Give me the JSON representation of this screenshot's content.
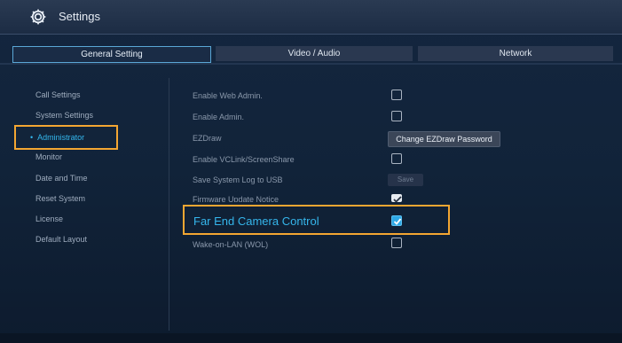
{
  "window": {
    "title": "Settings",
    "icon": "gear-icon"
  },
  "tabs": [
    {
      "label": "General Setting",
      "active": true
    },
    {
      "label": "Video / Audio",
      "active": false
    },
    {
      "label": "Network",
      "active": false
    }
  ],
  "sidebar": {
    "items": [
      {
        "label": "Call Settings"
      },
      {
        "label": "System Settings"
      },
      {
        "label": "Administrator",
        "active": true,
        "bullet": "•"
      },
      {
        "label": "Monitor"
      },
      {
        "label": "Date and Time"
      },
      {
        "label": "Reset System"
      },
      {
        "label": "License"
      },
      {
        "label": "Default Layout"
      }
    ]
  },
  "settings": {
    "rows": [
      {
        "label": "Enable Web Admin.",
        "control": "checkbox",
        "checked": false
      },
      {
        "label": "Enable Admin.",
        "control": "checkbox",
        "checked": false
      },
      {
        "label": "EZDraw",
        "control": "button",
        "button_label": "Change EZDraw Password"
      },
      {
        "label": "Enable VCLink/ScreenShare",
        "control": "checkbox",
        "checked": false
      },
      {
        "label": "Save System Log to USB",
        "control": "button",
        "button_label": "Save"
      },
      {
        "label": "Firmware Update Notice",
        "control": "checkbox",
        "checked": true
      },
      {
        "label": "Far End Camera Control",
        "control": "checkbox",
        "checked": true,
        "highlighted": true
      },
      {
        "label": "Wake-on-LAN (WOL)",
        "control": "checkbox",
        "checked": false
      }
    ]
  },
  "colors": {
    "accent": "#35b6ec",
    "highlight_box": "#f3a632",
    "background": "#13253d"
  }
}
